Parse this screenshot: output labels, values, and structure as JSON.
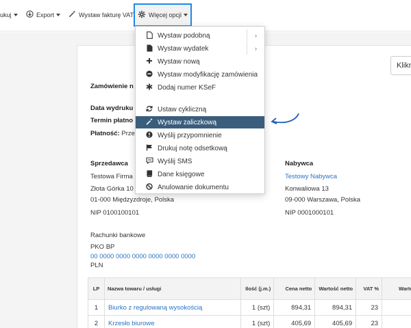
{
  "toolbar": {
    "print_label": "ukuj",
    "export_label": "Export",
    "invoice_label": "Wystaw fakturę VAT",
    "more_label": "Więcej opcji"
  },
  "menu": {
    "items": [
      {
        "label": "Wystaw podobną",
        "icon": "document-icon",
        "sub": "›"
      },
      {
        "label": "Wystaw wydatek",
        "icon": "document-filled-icon",
        "sub": "›"
      },
      {
        "label": "Wystaw nową",
        "icon": "plus-icon"
      },
      {
        "label": "Wystaw modyfikację zamówienia",
        "icon": "minus-circle-icon"
      },
      {
        "label": "Dodaj numer KSeF",
        "icon": "asterisk-icon"
      },
      {
        "label": "Ustaw cykliczną",
        "icon": "refresh-icon"
      },
      {
        "label": "Wystaw zaliczkową",
        "icon": "wand-icon"
      },
      {
        "label": "Wyślij przypomnienie",
        "icon": "exclamation-icon"
      },
      {
        "label": "Drukuj notę odsetkową",
        "icon": "flag-icon"
      },
      {
        "label": "Wyślij SMS",
        "icon": "sms-icon"
      },
      {
        "label": "Dane księgowe",
        "icon": "book-icon"
      },
      {
        "label": "Anulowanie dokumentu",
        "icon": "ban-icon"
      }
    ]
  },
  "doc": {
    "button_label": "Klikn",
    "order_label": "Zamówienie n",
    "print_date_label": "Data wydruku",
    "payment_term_label": "Termin płatno",
    "payment_label": "Płatność:",
    "payment_value": "Prze",
    "seller_heading": "Sprzedawca",
    "seller_name": "Testowa Firma",
    "seller_street": "Złota Górka 10",
    "seller_city": "01-000 Międzyzdroje, Polska",
    "seller_nip": "NIP 0100100101",
    "buyer_heading": "Nabywca",
    "buyer_name": "Testowy Nabywca",
    "buyer_street": "Konwaliowa 13",
    "buyer_city": "09-000 Warszawa, Polska",
    "buyer_nip": "NIP 0001000101",
    "bank_heading": "Rachunki bankowe",
    "bank_name": "PKO BP",
    "bank_account": "00 0000 0000 0000 0000 0000 0000",
    "bank_currency": "PLN"
  },
  "table": {
    "headers": {
      "lp": "LP",
      "name": "Nazwa towaru / usługi",
      "qty": "Ilość (j.m.)",
      "net_price": "Cena netto",
      "net_value": "Wartość netto",
      "vat": "VAT %",
      "gross": "Warto"
    },
    "rows": [
      {
        "lp": "1",
        "name": "Biurko z regulowaną wysokością",
        "qty": "1 (szt)",
        "net_price": "894,31",
        "net_value": "894,31",
        "vat": "23",
        "gross": ""
      },
      {
        "lp": "2",
        "name": "Krzesło biurowe",
        "qty": "1 (szt)",
        "net_price": "405,69",
        "net_value": "405,69",
        "vat": "23",
        "gross": ""
      }
    ]
  },
  "colors": {
    "highlight_border": "#1e88e5",
    "active_item": "#3b5d7c",
    "link": "#2a73c0",
    "arrow": "#1e5fb8"
  }
}
